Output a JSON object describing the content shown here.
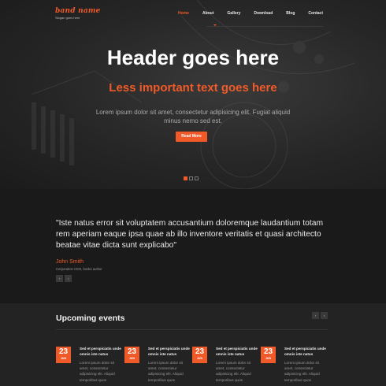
{
  "brand": {
    "name": "band name",
    "slogan": "Slogan goes here"
  },
  "nav": {
    "items": [
      {
        "label": "Home",
        "active": true
      },
      {
        "label": "About",
        "active": false
      },
      {
        "label": "Gallery",
        "active": false
      },
      {
        "label": "Download",
        "active": false
      },
      {
        "label": "Blog",
        "active": false
      },
      {
        "label": "Contact",
        "active": false
      }
    ]
  },
  "hero": {
    "title": "Header goes here",
    "subtitle": "Less important text goes here",
    "text": "Lorem ipsum dolor sit amet, consectetur adipisicing elit. Fugiat aliquid minus nemo sed est.",
    "button_label": "Read More",
    "slides": 3,
    "active_slide": 1
  },
  "testimonial": {
    "quote": "\"Iste natus error sit voluptatem accusantium doloremque laudantium totam rem aperiam eaque ipsa quae ab illo inventore veritatis et quasi architecto beatae vitae dicta sunt explicabo\"",
    "author": "John Smith",
    "role": "Corporation CEO, books author",
    "prev_icon": "‹",
    "next_icon": "›"
  },
  "events": {
    "title": "Upcoming events",
    "prev_icon": "‹",
    "next_icon": "›",
    "items": [
      {
        "day": "23",
        "month": "JUN",
        "title": "Sed et perspiciatis unde omnis iste natus",
        "text": "Lorem ipsum dolor sit amet, consectetur adipisicing elit. Aliquid temporibus quos"
      },
      {
        "day": "23",
        "month": "JUN",
        "title": "Sed et perspiciatis unde omnis iste natus",
        "text": "Lorem ipsum dolor sit amet, consectetur adipisicing elit. Aliquid temporibus quos"
      },
      {
        "day": "23",
        "month": "JUN",
        "title": "Sed et perspiciatis unde omnis iste natus",
        "text": "Lorem ipsum dolor sit amet, consectetur adipisicing elit. Aliquid temporibus quos"
      },
      {
        "day": "23",
        "month": "JUN",
        "title": "Sed et perspiciatis unde omnis iste natus",
        "text": "Lorem ipsum dolor sit amet, consectetur adipisicing elit. Aliquid temporibus quos"
      }
    ]
  },
  "colors": {
    "accent": "#f05a28",
    "background": "#1f1f1f"
  }
}
